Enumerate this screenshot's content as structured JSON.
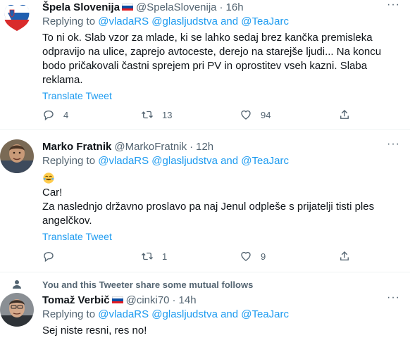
{
  "tweets": [
    {
      "name": "Špela Slovenija",
      "handle": "@SpelaSlovenija",
      "time": "16h",
      "replying_prefix": "Replying to ",
      "replying_to": "@vladaRS @glasljudstva and @TeaJarc",
      "text": "To ni ok. Slab vzor za mlade, ki se lahko sedaj brez kančka premisleka odpravijo na ulice, zaprejo avtoceste, derejo na starejše ljudi... Na koncu bodo pričakovali častni sprejem pri PV in oprostitev vseh kazni. Slaba reklama.",
      "translate": "Translate Tweet",
      "replies": "4",
      "retweets": "13",
      "likes": "94"
    },
    {
      "name": "Marko Fratnik",
      "handle": "@MarkoFratnik",
      "time": "12h",
      "replying_prefix": "Replying to ",
      "replying_to": "@vladaRS @glasljudstva and @TeaJarc",
      "line1": "Car!",
      "line2": "Za naslednjo državno proslavo pa naj Jenul odpleše s prijatelji tisti ples angelčkov.",
      "translate": "Translate Tweet",
      "replies": "",
      "retweets": "1",
      "likes": "9"
    },
    {
      "name": "Tomaž Verbič",
      "handle": "@cinki70",
      "time": "14h",
      "replying_prefix": "Replying to ",
      "replying_to": "@vladaRS @glasljudstva and @TeaJarc",
      "text": "Sej niste resni, res no!"
    }
  ],
  "mutual_follows": "You and this Tweeter share some mutual follows",
  "dot": "·",
  "more": "···",
  "icons": {
    "reply": "reply-icon",
    "retweet": "retweet-icon",
    "like": "heart-icon",
    "share": "share-icon",
    "flag": "slovenia-flag-icon",
    "person": "person-icon"
  },
  "colors": {
    "link": "#1d9bf0",
    "muted": "#536471",
    "text": "#0f1419"
  }
}
